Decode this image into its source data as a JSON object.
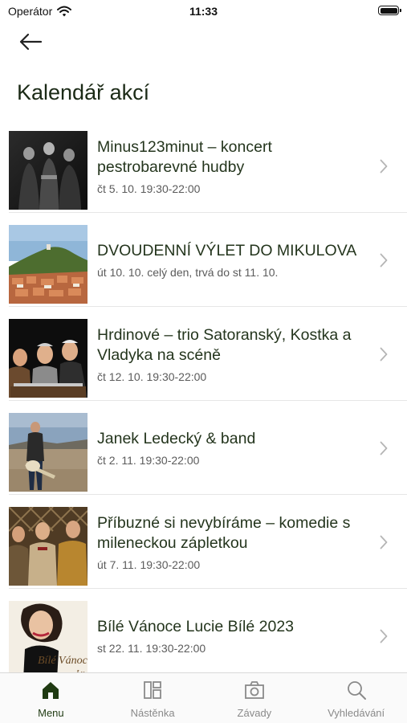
{
  "status_bar": {
    "carrier": "Operátor",
    "time": "11:33"
  },
  "header": {
    "title": "Kalendář akcí"
  },
  "events": [
    {
      "title": "Minus123minut – koncert pestrobarevné hudby",
      "date": "čt 5. 10. 19:30-22:00",
      "image": "band-photo"
    },
    {
      "title": "DVOUDENNÍ VÝLET DO MIKULOVA",
      "date": "út 10. 10. celý den, trvá do st 11. 10.",
      "image": "town-photo"
    },
    {
      "title": "Hrdinové – trio Satoranský, Kostka a Vladyka na scéně",
      "date": "čt 12. 10. 19:30-22:00",
      "image": "actors-photo"
    },
    {
      "title": "Janek Ledecký & band",
      "date": "čt 2. 11. 19:30-22:00",
      "image": "musician-photo"
    },
    {
      "title": "Příbuzné si nevybíráme – komedie s mileneckou zápletkou",
      "date": "út 7. 11. 19:30-22:00",
      "image": "comedy-photo"
    },
    {
      "title": "Bílé Vánoce Lucie Bílé 2023",
      "date": "st 22. 11. 19:30-22:00",
      "image": "singer-photo",
      "image_text": "Bílé Vánoce",
      "image_text2": "Lu"
    }
  ],
  "tabbar": {
    "active": "menu",
    "tabs": [
      {
        "id": "menu",
        "label": "Menu",
        "icon": "home-icon"
      },
      {
        "id": "board",
        "label": "Nástěnka",
        "icon": "board-icon"
      },
      {
        "id": "defects",
        "label": "Závady",
        "icon": "camera-icon"
      },
      {
        "id": "search",
        "label": "Vyhledávání",
        "icon": "search-icon"
      }
    ]
  },
  "colors": {
    "accent": "#1f3a12",
    "title_text": "#24351d",
    "date_text": "#5b5b5b",
    "tab_inactive": "#8a8a8a"
  }
}
